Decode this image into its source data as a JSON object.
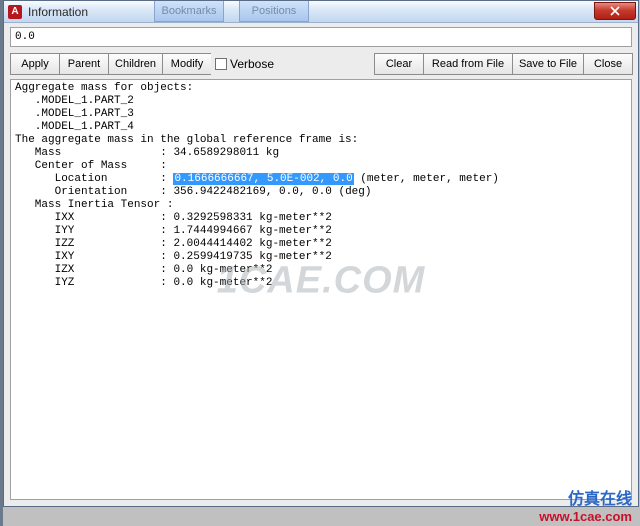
{
  "window": {
    "app_letter": "A",
    "title": "Information",
    "bg_tab1": "Bookmarks",
    "bg_tab2": "Positions"
  },
  "input": {
    "value": "0.0"
  },
  "toolbar": {
    "apply": "Apply",
    "parent": "Parent",
    "children": "Children",
    "modify": "Modify",
    "verbose": "Verbose",
    "clear": "Clear",
    "read": "Read from File",
    "save": "Save to File",
    "close": "Close"
  },
  "report": {
    "hdr_objects": "Aggregate mass for objects:",
    "obj1": "   .MODEL_1.PART_2",
    "obj2": "   .MODEL_1.PART_3",
    "obj3": "   .MODEL_1.PART_4",
    "hdr_frame": "The aggregate mass in the global reference frame is:",
    "mass_lbl": "   Mass               : ",
    "mass_val": "34.6589298011 kg",
    "com_lbl": "   Center of Mass     :",
    "loc_lbl": "      Location        : ",
    "loc_sel": "0.1666666667, 5.0E-002, 0.0",
    "loc_unit": " (meter, meter, meter)",
    "ori_lbl": "      Orientation     : ",
    "ori_val": "356.9422482169, 0.0, 0.0 (deg)",
    "mit_lbl": "   Mass Inertia Tensor :",
    "ixx_lbl": "      IXX             : ",
    "ixx_val": "0.3292598331 kg-meter**2",
    "iyy_lbl": "      IYY             : ",
    "iyy_val": "1.7444994667 kg-meter**2",
    "izz_lbl": "      IZZ             : ",
    "izz_val": "2.0044414402 kg-meter**2",
    "ixy_lbl": "      IXY             : ",
    "ixy_val": "0.2599419735 kg-meter**2",
    "izx_lbl": "      IZX             : ",
    "izx_val": "0.0 kg-meter**2",
    "iyz_lbl": "      IYZ             : ",
    "iyz_val": "0.0 kg-meter**2"
  },
  "watermark": "1CAE.COM",
  "footer": {
    "cn": "仿真在线",
    "url": "www.1cae.com"
  }
}
